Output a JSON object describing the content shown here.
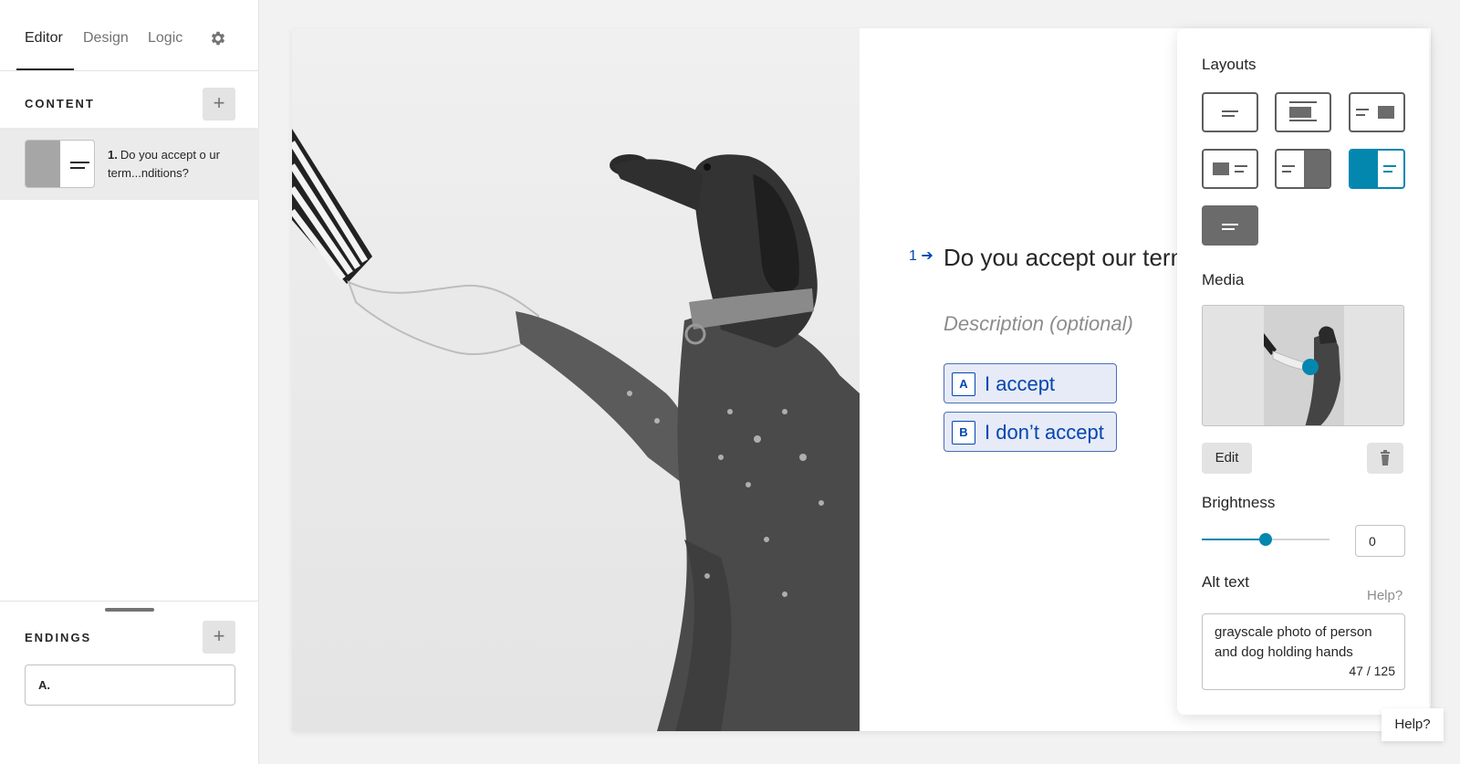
{
  "tabs": {
    "editor": "Editor",
    "design": "Design",
    "logic": "Logic"
  },
  "sidebar": {
    "content_title": "CONTENT",
    "add_content_label": "+",
    "question_item": {
      "number": "1.",
      "text": "Do you accept o ur term...nditions?"
    },
    "endings_title": "ENDINGS",
    "add_ending_label": "+",
    "ending_item": "A."
  },
  "question": {
    "index": "1",
    "title": "Do you accept our terms and conditions?",
    "description": "Description (optional)",
    "choices": [
      {
        "key": "A",
        "label": "I accept"
      },
      {
        "key": "B",
        "label": "I don’t accept"
      }
    ]
  },
  "panel": {
    "layouts_label": "Layouts",
    "media_label": "Media",
    "edit_label": "Edit",
    "brightness_label": "Brightness",
    "brightness_value": "0",
    "brightness_fraction": 0.5,
    "alt_text_label": "Alt text",
    "help_label": "Help?",
    "alt_text_value": "grayscale photo of person and dog holding hands",
    "alt_text_count": "47 / 125"
  },
  "help_button": "Help?",
  "colors": {
    "accent": "#0487af",
    "choice_text": "#0445af",
    "choice_bg": "#e6ebf7"
  }
}
